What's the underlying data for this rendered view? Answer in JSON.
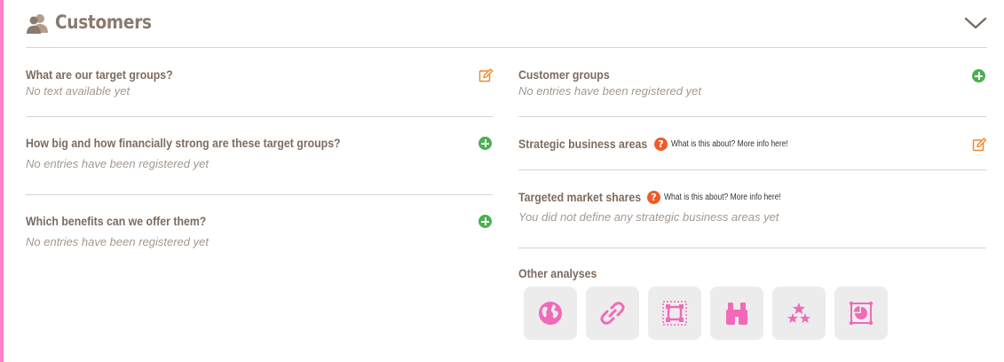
{
  "header": {
    "title": "Customers",
    "icon": "customers-icon",
    "collapse_icon": "chevron-down-icon"
  },
  "left": [
    {
      "title": "What are our target groups?",
      "subtitle": "No text available yet",
      "action": "edit-icon"
    },
    {
      "title": "How big and how financially strong are these target groups?",
      "subtitle": "No entries have been registered yet",
      "action": "add-icon"
    },
    {
      "title": "Which benefits can we offer them?",
      "subtitle": "No entries have been registered yet",
      "action": "add-icon"
    }
  ],
  "right": {
    "customer_groups": {
      "title": "Customer groups",
      "subtitle": "No entries have been registered yet",
      "action": "add-icon"
    },
    "strategic_areas": {
      "title": "Strategic business areas",
      "help_text": "What is this about? More info here!",
      "action": "edit-icon"
    },
    "market_shares": {
      "title": "Targeted market shares",
      "help_text": "What is this about? More info here!",
      "subtitle": "You did not define any strategic business areas yet"
    },
    "other_analyses": {
      "title": "Other analyses",
      "icons": [
        "globe-icon",
        "link-icon",
        "matrix-icon",
        "binoculars-icon",
        "stars-icon",
        "chart-icon"
      ]
    }
  },
  "colors": {
    "accent": "#ff7fc8",
    "add": "#4caf50",
    "edit": "#f0872a",
    "help": "#f05a28",
    "text": "#7d6b5f"
  }
}
